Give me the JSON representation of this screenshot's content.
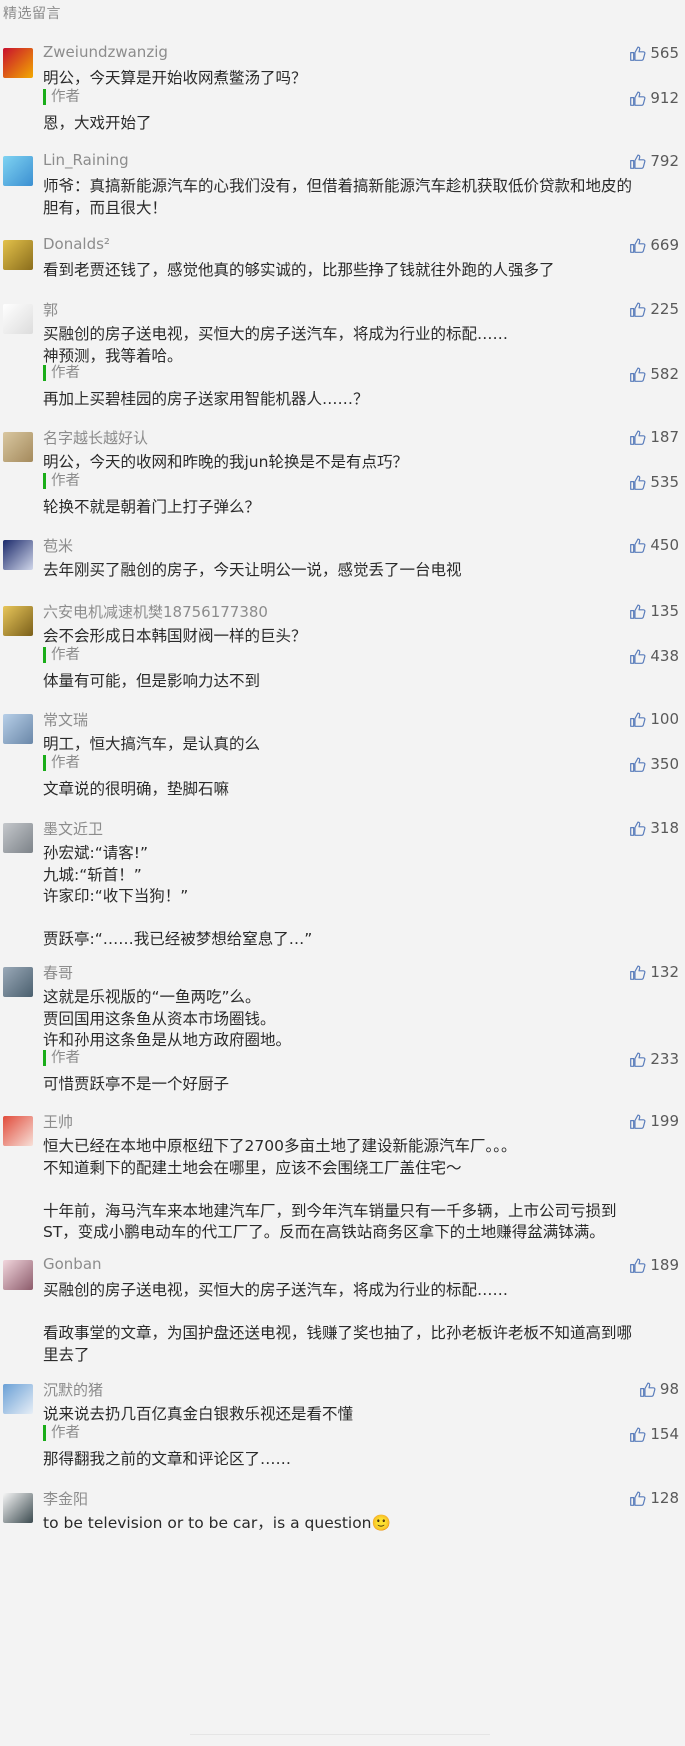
{
  "header": {
    "title": "精选留言"
  },
  "comments": [
    {
      "nickname": "Zweiundzwanzig",
      "likes": "565",
      "content": [
        "明公，今天算是开始收网煮鳖汤了吗？"
      ],
      "reply": {
        "author_label": "作者",
        "likes": "912",
        "content": [
          "恩，大戏开始了"
        ]
      }
    },
    {
      "nickname": "Lin_Raining",
      "likes": "792",
      "content": [
        "师爷：真搞新能源汽车的心我们没有，但借着搞新能源汽车趁机获取低价贷款和地皮的",
        "胆有，而且很大！"
      ]
    },
    {
      "nickname": "Donalds²",
      "likes": "669",
      "content": [
        "看到老贾还钱了，感觉他真的够实诚的，比那些挣了钱就往外跑的人强多了"
      ]
    },
    {
      "nickname": "郭",
      "likes": "225",
      "content": [
        "买融创的房子送电视，买恒大的房子送汽车，将成为行业的标配……",
        "神预测，我等着哈。"
      ],
      "reply": {
        "author_label": "作者",
        "likes": "582",
        "content": [
          "再加上买碧桂园的房子送家用智能机器人……？"
        ]
      }
    },
    {
      "nickname": "名字越长越好认",
      "likes": "187",
      "content": [
        "明公，今天的收网和昨晚的我jun轮换是不是有点巧？"
      ],
      "reply": {
        "author_label": "作者",
        "likes": "535",
        "content": [
          "轮换不就是朝着门上打子弹么？"
        ]
      }
    },
    {
      "nickname": "苞米",
      "likes": "450",
      "content": [
        "去年刚买了融创的房子，今天让明公一说，感觉丢了一台电视"
      ]
    },
    {
      "nickname": "六安电机减速机樊18756177380",
      "likes": "135",
      "content": [
        "会不会形成日本韩国财阀一样的巨头？"
      ],
      "reply": {
        "author_label": "作者",
        "likes": "438",
        "content": [
          "体量有可能，但是影响力达不到"
        ]
      }
    },
    {
      "nickname": "常文瑞",
      "likes": "100",
      "content": [
        "明工，恒大搞汽车，是认真的么"
      ],
      "reply": {
        "author_label": "作者",
        "likes": "350",
        "content": [
          "文章说的很明确，垫脚石嘛"
        ]
      }
    },
    {
      "nickname": "墨文近卫",
      "likes": "318",
      "content": [
        "孙宏斌:“请客!”",
        "九城:“斩首！”",
        "许家印:“收下当狗！”",
        "",
        "贾跃亭:“……我已经被梦想给窒息了…”"
      ]
    },
    {
      "nickname": "春哥",
      "likes": "132",
      "content": [
        "这就是乐视版的“一鱼两吃”么。",
        "贾回国用这条鱼从资本市场圈钱。",
        "许和孙用这条鱼是从地方政府圈地。"
      ],
      "reply": {
        "author_label": "作者",
        "likes": "233",
        "content": [
          "可惜贾跃亭不是一个好厨子"
        ]
      }
    },
    {
      "nickname": "王帅",
      "likes": "199",
      "content": [
        "恒大已经在本地中原枢纽下了2700多亩土地了建设新能源汽车厂。。。",
        "不知道剩下的配建土地会在哪里，应该不会围绕工厂盖住宅～",
        "",
        "十年前，海马汽车来本地建汽车厂，到今年汽车销量只有一千多辆，上市公司亏损到",
        "ST，变成小鹏电动车的代工厂了。反而在高铁站商务区拿下的土地赚得盆满钵满。"
      ]
    },
    {
      "nickname": "Gonban",
      "likes": "189",
      "content": [
        "买融创的房子送电视，买恒大的房子送汽车，将成为行业的标配……",
        "",
        "看政事堂的文章，为国护盘还送电视，钱赚了奖也抽了，比孙老板许老板不知道高到哪",
        "里去了"
      ]
    },
    {
      "nickname": "沉默的猪",
      "likes": "98",
      "content": [
        "说来说去扔几百亿真金白银救乐视还是看不懂"
      ],
      "reply": {
        "author_label": "作者",
        "likes": "154",
        "content": [
          "那得翻我之前的文章和评论区了……"
        ]
      }
    },
    {
      "nickname": "李金阳",
      "likes": "128",
      "content": [
        "to be television or to be car，is a  question🙂"
      ]
    }
  ]
}
